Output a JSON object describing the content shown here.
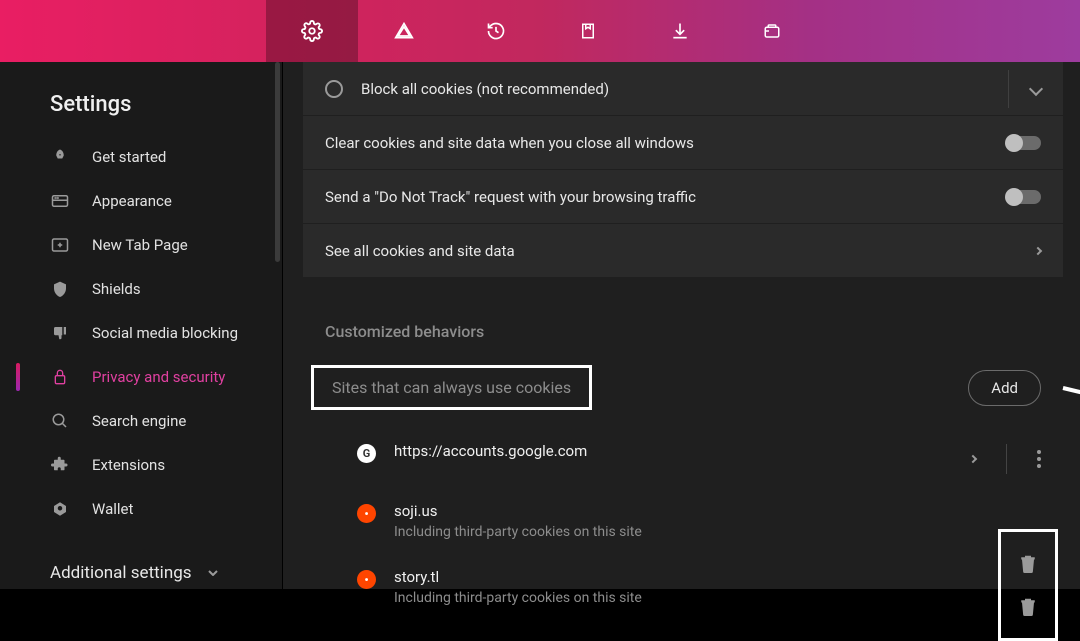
{
  "topbar": {
    "icons": [
      "settings-gear",
      "warning-triangle",
      "history",
      "bookmark",
      "download",
      "wallet"
    ]
  },
  "sidebar": {
    "title": "Settings",
    "items": [
      {
        "icon": "rocket",
        "label": "Get started"
      },
      {
        "icon": "appearance",
        "label": "Appearance"
      },
      {
        "icon": "newtab",
        "label": "New Tab Page"
      },
      {
        "icon": "shield",
        "label": "Shields"
      },
      {
        "icon": "thumbdown",
        "label": "Social media blocking"
      },
      {
        "icon": "lock",
        "label": "Privacy and security"
      },
      {
        "icon": "search",
        "label": "Search engine"
      },
      {
        "icon": "extension",
        "label": "Extensions"
      },
      {
        "icon": "wallet",
        "label": "Wallet"
      }
    ],
    "additional": "Additional settings"
  },
  "cookies": {
    "block_all": "Block all cookies (not recommended)",
    "clear_on_close": "Clear cookies and site data when you close all windows",
    "dnt": "Send a \"Do Not Track\" request with your browsing traffic",
    "see_all": "See all cookies and site data"
  },
  "behaviors": {
    "section_title": "Customized behaviors",
    "allow_label": "Sites that can always use cookies",
    "add_label": "Add",
    "sites": [
      {
        "favicon": "g",
        "domain": "https://accounts.google.com",
        "sub": ""
      },
      {
        "favicon": "r",
        "domain": "soji.us",
        "sub": "Including third-party cookies on this site"
      },
      {
        "favicon": "r",
        "domain": "story.tl",
        "sub": "Including third-party cookies on this site"
      }
    ]
  }
}
